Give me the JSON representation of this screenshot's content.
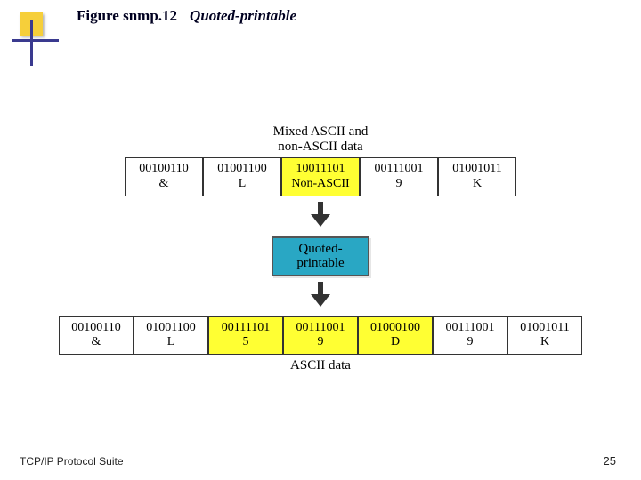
{
  "header": {
    "figure_label": "Figure snmp.12",
    "figure_title": "Quoted-printable"
  },
  "diagram": {
    "top_caption_l1": "Mixed ASCII and",
    "top_caption_l2": "non-ASCII data",
    "row_in": [
      {
        "bits": "00100110",
        "sym": "&",
        "hl": false
      },
      {
        "bits": "01001100",
        "sym": "L",
        "hl": false
      },
      {
        "bits": "10011101",
        "sym": "Non-ASCII",
        "hl": true
      },
      {
        "bits": "00111001",
        "sym": "9",
        "hl": false
      },
      {
        "bits": "01001011",
        "sym": "K",
        "hl": false
      }
    ],
    "process_l1": "Quoted-",
    "process_l2": "printable",
    "row_out": [
      {
        "bits": "00100110",
        "sym": "&",
        "hl": false
      },
      {
        "bits": "01001100",
        "sym": "L",
        "hl": false
      },
      {
        "bits": "00111101",
        "sym": "5",
        "hl": true
      },
      {
        "bits": "00111001",
        "sym": "9",
        "hl": true
      },
      {
        "bits": "01000100",
        "sym": "D",
        "hl": true
      },
      {
        "bits": "00111001",
        "sym": "9",
        "hl": false
      },
      {
        "bits": "01001011",
        "sym": "K",
        "hl": false
      }
    ],
    "bottom_caption": "ASCII data"
  },
  "footer": {
    "left": "TCP/IP Protocol Suite",
    "page": "25"
  }
}
